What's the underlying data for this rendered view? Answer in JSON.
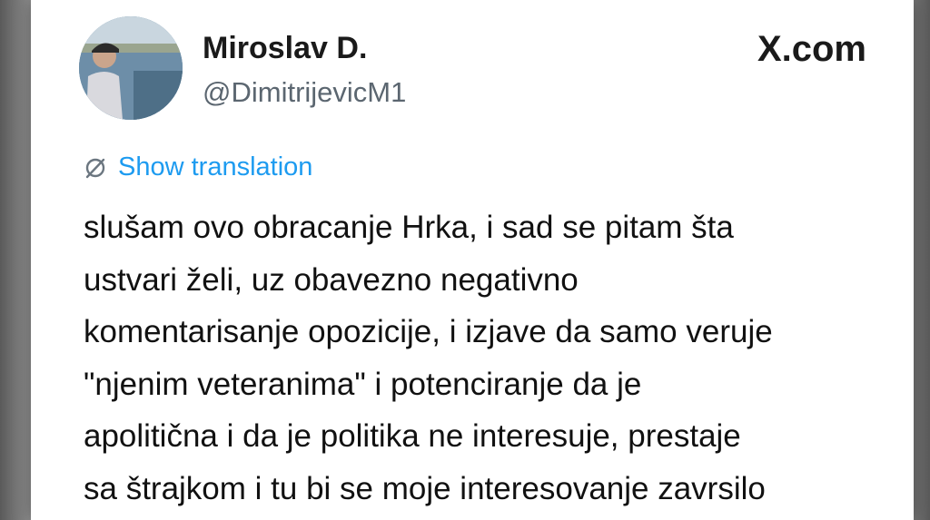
{
  "author": {
    "name": "Miroslav D.",
    "handle": "@DimitrijevicM1"
  },
  "source": {
    "label": "X.com",
    "icon": "x-logo"
  },
  "translation": {
    "label": "Show translation",
    "icon": "globe-icon"
  },
  "tweet": {
    "lines": [
      "slušam ovo obracanje Hrka, i sad se pitam šta",
      "ustvari želi, uz obavezno negativno",
      "komentarisanje opozicije, i izjave da samo veruje",
      "\"njenim veteranima\" i potenciranje da je",
      "apolitična i da je politika ne interesuje, prestaje",
      "sa štrajkom i tu bi se moje interesovanje zavrsilo"
    ]
  },
  "colors": {
    "link": "#1d9bf0",
    "text": "#111111",
    "handle": "#5b6670"
  }
}
